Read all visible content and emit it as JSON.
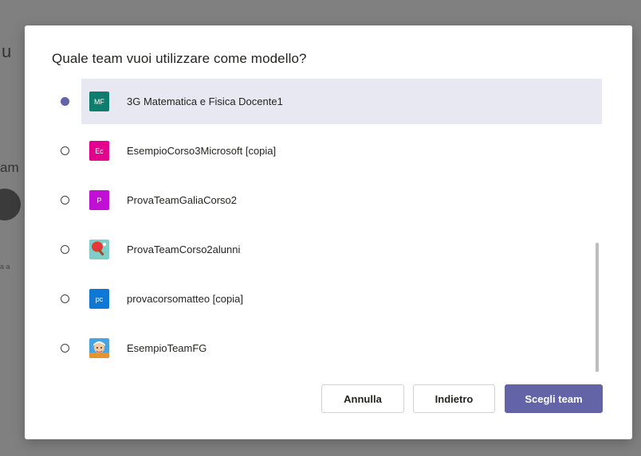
{
  "background": {
    "fragment_top": "u",
    "fragment_mid": "am",
    "fragment_small": "a a"
  },
  "dialog": {
    "title": "Quale team vuoi utilizzare come modello?",
    "teams": [
      {
        "initials": "MF",
        "name": "3G Matematica e Fisica Docente1",
        "color": "#0f7d6e",
        "selected": true,
        "avatar_icon": "initials"
      },
      {
        "initials": "Ec",
        "name": "EsempioCorso3Microsoft [copia]",
        "color": "#e3008c",
        "selected": false,
        "avatar_icon": "initials"
      },
      {
        "initials": "P",
        "name": "ProvaTeamGaliaCorso2",
        "color": "#c10fd5",
        "selected": false,
        "avatar_icon": "initials"
      },
      {
        "initials": "",
        "name": "ProvaTeamCorso2alunni",
        "color": "#7ecfc9",
        "selected": false,
        "avatar_icon": "ping-pong-icon"
      },
      {
        "initials": "pc",
        "name": "provacorsomatteo [copia]",
        "color": "#0f78d4",
        "selected": false,
        "avatar_icon": "initials"
      },
      {
        "initials": "",
        "name": "EsempioTeamFG",
        "color": "#4aa3df",
        "selected": false,
        "avatar_icon": "cartoon-person-icon"
      }
    ],
    "buttons": {
      "cancel": "Annulla",
      "back": "Indietro",
      "choose": "Scegli team"
    },
    "accent_color": "#6264a7"
  }
}
